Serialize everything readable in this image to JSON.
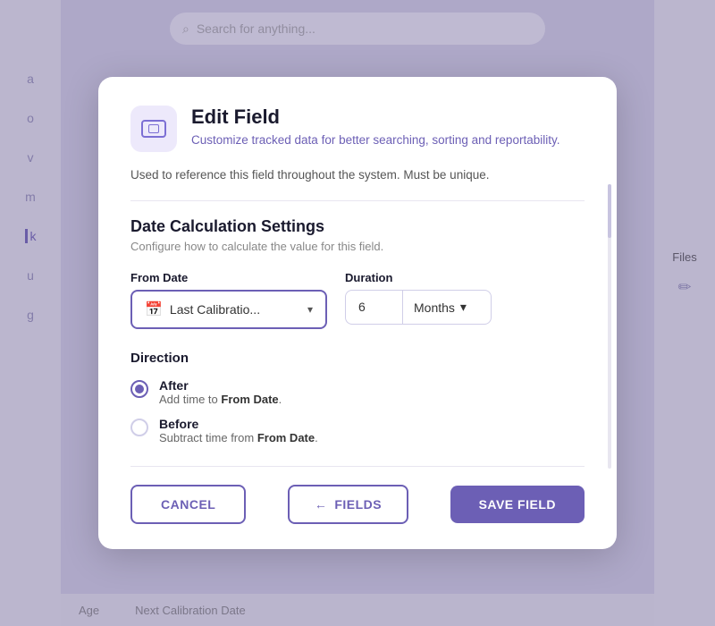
{
  "background": {
    "search_placeholder": "Search for anything...",
    "sidebar_letters": [
      "a",
      "o",
      "v",
      "m",
      "k",
      "u",
      "g"
    ],
    "active_letter": "k",
    "files_label": "Files",
    "bottom_cols": [
      "Age",
      "Next Calibration Date"
    ]
  },
  "modal": {
    "icon_label": "field-icon",
    "title": "Edit Field",
    "subtitle_plain": "Customize tracked data for ",
    "subtitle_link": "better searching, sorting and reportability.",
    "description": "Used to reference this field throughout the system. Must be unique.",
    "section_title": "Date Calculation Settings",
    "section_subtitle": "Configure how to calculate the value for this field.",
    "from_date_label": "From Date",
    "from_date_value": "Last Calibratio...",
    "duration_label": "Duration",
    "duration_number": "6",
    "duration_unit": "Months",
    "direction_title": "Direction",
    "options": [
      {
        "label": "After",
        "description_plain": "Add time to ",
        "description_bold": "From Date",
        "description_end": ".",
        "selected": true
      },
      {
        "label": "Before",
        "description_plain": "Subtract time from ",
        "description_bold": "From Date",
        "description_end": ".",
        "selected": false
      }
    ],
    "footer": {
      "cancel_label": "CANCEL",
      "fields_label": "FIELDS",
      "save_label": "SAVE FIELD"
    }
  }
}
